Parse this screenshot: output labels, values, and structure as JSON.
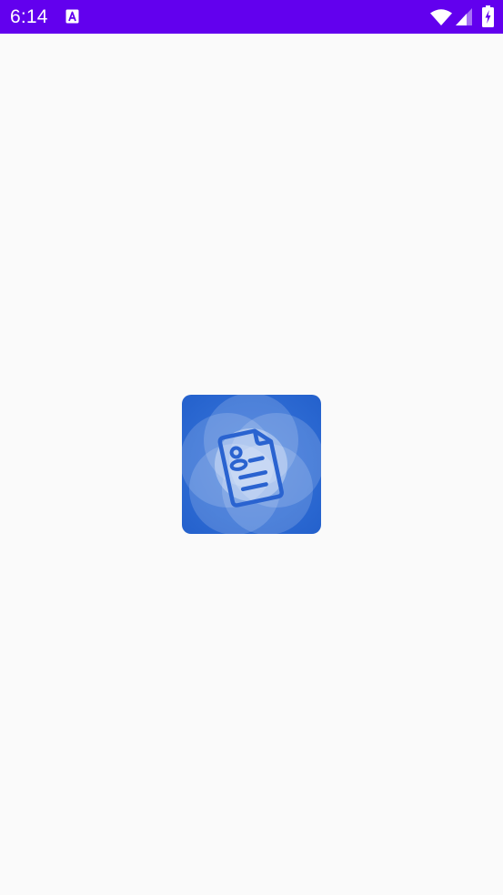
{
  "status_bar": {
    "time": "6:14",
    "background_color": "#6200ee",
    "icons": [
      "notification-a-icon",
      "wifi-icon",
      "cellular-signal-icon",
      "battery-charging-icon"
    ]
  },
  "splash": {
    "background_color": "#fafafa",
    "logo_icon": "resume-document-icon",
    "logo_colors": {
      "primary": "#2a63d0",
      "light": "#dbe6f8"
    }
  }
}
